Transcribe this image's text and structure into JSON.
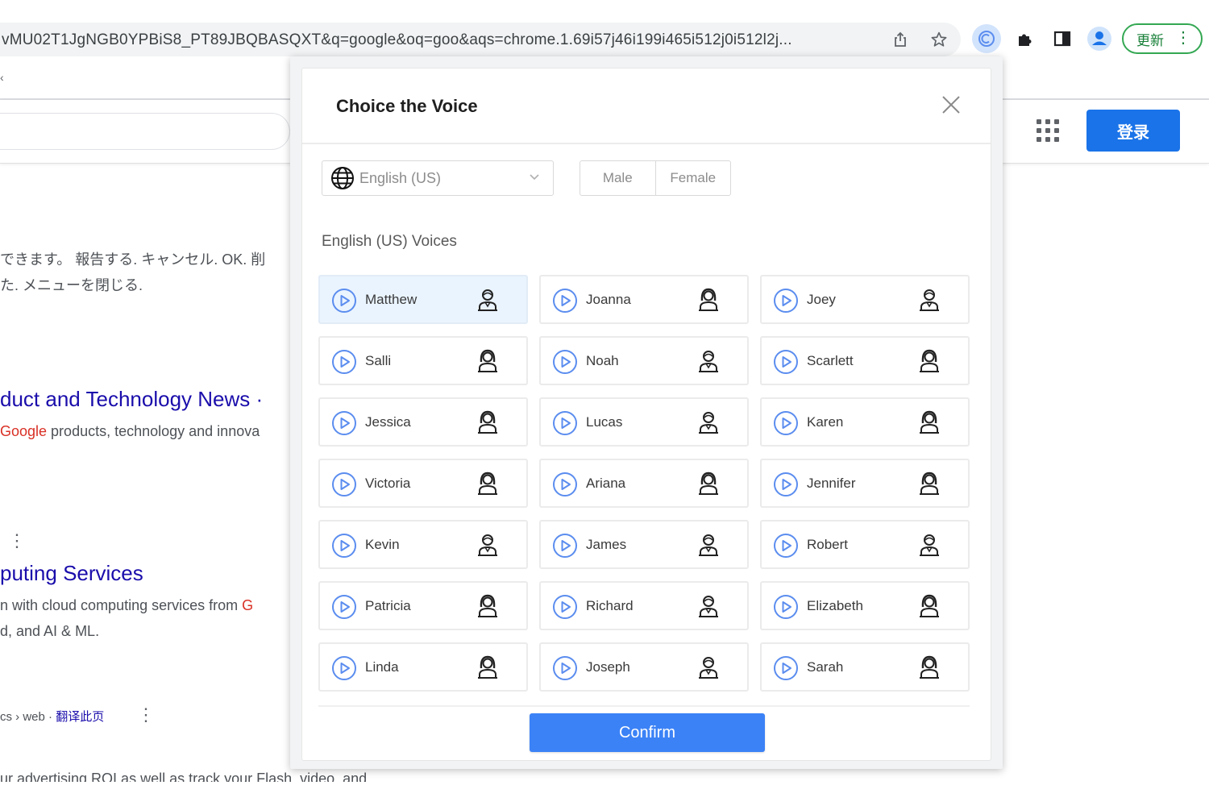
{
  "browser": {
    "url": "vMU02T1JgNGB0YPBiS8_PT89JBQBASQXT&q=google&oq=goo&aqs=chrome.1.69i57j46i199i465i512j0i512l2j...",
    "update_label": "更新"
  },
  "header": {
    "signin_label": "登录"
  },
  "background": {
    "jp_line_1": "できます。 報告する. キャンセル. OK. 削",
    "jp_line_2": "た. メニューを閉じる.",
    "result1_title": "duct and Technology News ·",
    "result1_snippet_hl": "Google",
    "result1_snippet": " products, technology and innova",
    "result2_title": "puting Services",
    "result2_snippet_1": "n with cloud computing services from ",
    "result2_snippet_1_hl": "G",
    "result2_snippet_2": "d, and AI & ML.",
    "crumb": "cs › web · ",
    "crumb_link": "翻译此页",
    "bottom_line": "ur advertising ROI as well as track your Flash, video, and"
  },
  "dialog": {
    "title": "Choice the Voice",
    "language": "English (US)",
    "gender_options": [
      "Male",
      "Female"
    ],
    "section_heading": "English (US) Voices",
    "confirm_label": "Confirm",
    "selected_voice": "Matthew",
    "voices": [
      {
        "name": "Matthew",
        "gender": "male"
      },
      {
        "name": "Joanna",
        "gender": "female"
      },
      {
        "name": "Joey",
        "gender": "male"
      },
      {
        "name": "Salli",
        "gender": "female"
      },
      {
        "name": "Noah",
        "gender": "male"
      },
      {
        "name": "Scarlett",
        "gender": "female"
      },
      {
        "name": "Jessica",
        "gender": "female"
      },
      {
        "name": "Lucas",
        "gender": "male"
      },
      {
        "name": "Karen",
        "gender": "female"
      },
      {
        "name": "Victoria",
        "gender": "female"
      },
      {
        "name": "Ariana",
        "gender": "female"
      },
      {
        "name": "Jennifer",
        "gender": "female"
      },
      {
        "name": "Kevin",
        "gender": "male"
      },
      {
        "name": "James",
        "gender": "male"
      },
      {
        "name": "Robert",
        "gender": "male"
      },
      {
        "name": "Patricia",
        "gender": "female"
      },
      {
        "name": "Richard",
        "gender": "male"
      },
      {
        "name": "Elizabeth",
        "gender": "female"
      },
      {
        "name": "Linda",
        "gender": "female"
      },
      {
        "name": "Joseph",
        "gender": "male"
      },
      {
        "name": "Sarah",
        "gender": "female"
      }
    ]
  },
  "colors": {
    "accent": "#3b82f6",
    "signin": "#1a73e8",
    "icon_blue": "#5b8def",
    "selected_bg": "#eaf4ff",
    "link": "#1a0dab",
    "update_green": "#34a853"
  },
  "icons": [
    "share-icon",
    "star-icon",
    "extension-active-icon",
    "puzzle-icon",
    "side-panel-icon",
    "profile-icon",
    "apps-icon",
    "globe-icon",
    "chevron-down-icon",
    "close-icon",
    "play-icon",
    "male-person-icon",
    "female-person-icon"
  ]
}
